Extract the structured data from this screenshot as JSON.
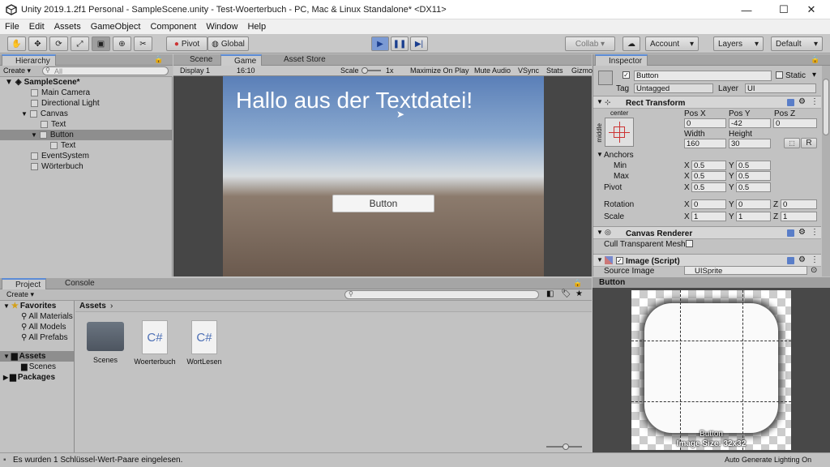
{
  "titlebar": {
    "title": "Unity 2019.1.2f1 Personal - SampleScene.unity - Test-Woerterbuch - PC, Mac & Linux Standalone* <DX11>",
    "minimize": "—",
    "maximize": "☐",
    "close": "✕"
  },
  "menu": [
    "File",
    "Edit",
    "Assets",
    "GameObject",
    "Component",
    "Window",
    "Help"
  ],
  "toolbar": {
    "pivot": "Pivot",
    "global": "Global",
    "collab": "Collab ▾",
    "account": "Account",
    "layers": "Layers",
    "layout": "Default"
  },
  "hierarchy": {
    "tab": "Hierarchy",
    "create": "Create",
    "search": "All",
    "items": [
      "SampleScene*",
      "Main Camera",
      "Directional Light",
      "Canvas",
      "Text",
      "Button",
      "Text",
      "EventSystem",
      "Wörterbuch"
    ]
  },
  "scene_tabs": {
    "scene": "Scene",
    "game": "Game",
    "store": "Asset Store"
  },
  "game_toolbar": {
    "display": "Display 1",
    "aspect": "16:10",
    "scale_label": "Scale",
    "scale_value": "1x",
    "maximize": "Maximize On Play",
    "mute": "Mute Audio",
    "vsync": "VSync",
    "stats": "Stats",
    "gizmos": "Gizmo"
  },
  "game_view": {
    "heading": "Hallo aus der Textdatei!",
    "button": "Button"
  },
  "inspector": {
    "tab": "Inspector",
    "name": "Button",
    "static": "Static",
    "tag_label": "Tag",
    "tag": "Untagged",
    "layer_label": "Layer",
    "layer": "UI",
    "rect": {
      "title": "Rect Transform",
      "anchor_h": "center",
      "anchor_v": "middle",
      "posx_l": "Pos X",
      "posy_l": "Pos Y",
      "posz_l": "Pos Z",
      "posx": "0",
      "posy": "-42",
      "posz": "0",
      "width_l": "Width",
      "height_l": "Height",
      "width": "160",
      "height": "30",
      "r_btn": "R",
      "anchors": "Anchors",
      "min": "Min",
      "max": "Max",
      "pivot": "Pivot",
      "x": "X",
      "y": "Y",
      "z": "Z",
      "min_x": "0.5",
      "min_y": "0.5",
      "max_x": "0.5",
      "max_y": "0.5",
      "pivot_x": "0.5",
      "pivot_y": "0.5",
      "rotation": "Rotation",
      "rot_x": "0",
      "rot_y": "0",
      "rot_z": "0",
      "scale": "Scale",
      "sc_x": "1",
      "sc_y": "1",
      "sc_z": "1"
    },
    "canvas_renderer": "Canvas Renderer",
    "cull": "Cull Transparent Mesh",
    "image_script": "Image (Script)",
    "source_label": "Source Image",
    "source": "UISprite"
  },
  "preview": {
    "title": "Button",
    "name": "Button",
    "size": "Image Size: 32x32"
  },
  "project": {
    "tab": "Project",
    "console": "Console",
    "create": "Create",
    "favorites": "Favorites",
    "fav_items": [
      "All Materials",
      "All Models",
      "All Prefabs"
    ],
    "assets": "Assets",
    "scenes": "Scenes",
    "packages": "Packages",
    "breadcrumb": "Assets",
    "files": [
      "Scenes",
      "Woerterbuch",
      "WortLesen"
    ]
  },
  "statusbar": {
    "message": "Es wurden 1 Schlüssel-Wert-Paare eingelesen.",
    "right": "Auto Generate Lighting On"
  }
}
